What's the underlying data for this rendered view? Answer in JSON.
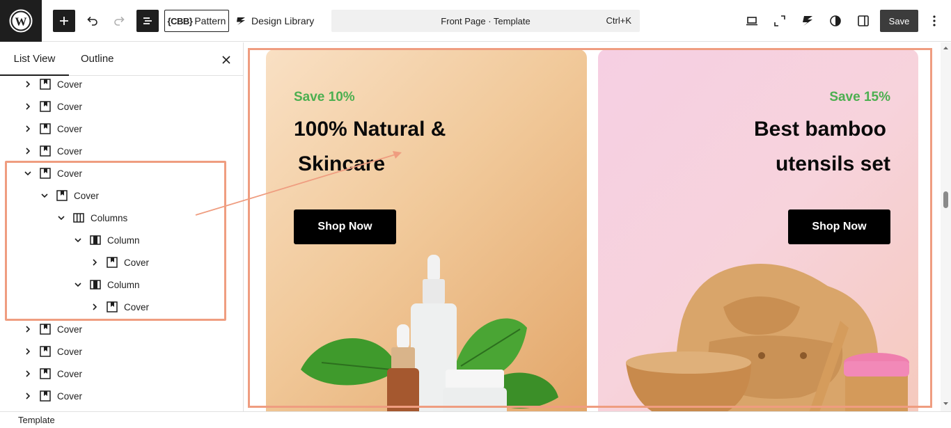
{
  "toolbar": {
    "pattern_mark": "{CBB}",
    "pattern_label": "Pattern",
    "design_library_label": "Design Library",
    "command_title": "Front Page · Template",
    "command_shortcut": "Ctrl+K",
    "save_label": "Save"
  },
  "sidebar": {
    "tabs": [
      "List View",
      "Outline"
    ],
    "tree": [
      {
        "label": "Cover",
        "level": 0,
        "expanded": false,
        "icon": "cover-icon"
      },
      {
        "label": "Cover",
        "level": 0,
        "expanded": false,
        "icon": "cover-icon"
      },
      {
        "label": "Cover",
        "level": 0,
        "expanded": false,
        "icon": "cover-icon"
      },
      {
        "label": "Cover",
        "level": 0,
        "expanded": false,
        "icon": "cover-icon"
      },
      {
        "label": "Cover",
        "level": 0,
        "expanded": true,
        "icon": "cover-icon"
      },
      {
        "label": "Cover",
        "level": 1,
        "expanded": true,
        "icon": "cover-icon"
      },
      {
        "label": "Columns",
        "level": 2,
        "expanded": true,
        "icon": "columns-icon"
      },
      {
        "label": "Column",
        "level": 3,
        "expanded": true,
        "icon": "column-icon"
      },
      {
        "label": "Cover",
        "level": 4,
        "expanded": false,
        "icon": "cover-icon"
      },
      {
        "label": "Column",
        "level": 3,
        "expanded": true,
        "icon": "column-icon"
      },
      {
        "label": "Cover",
        "level": 4,
        "expanded": false,
        "icon": "cover-icon"
      },
      {
        "label": "Cover",
        "level": 0,
        "expanded": false,
        "icon": "cover-icon"
      },
      {
        "label": "Cover",
        "level": 0,
        "expanded": false,
        "icon": "cover-icon"
      },
      {
        "label": "Cover",
        "level": 0,
        "expanded": false,
        "icon": "cover-icon"
      },
      {
        "label": "Cover",
        "level": 0,
        "expanded": false,
        "icon": "cover-icon"
      }
    ]
  },
  "status": {
    "label": "Template"
  },
  "canvas": {
    "left_card": {
      "save_text": "Save 10%",
      "headline_line1": "100% Natural &",
      "headline_line2": "Skincare",
      "button": "Shop Now"
    },
    "right_card": {
      "save_text": "Save 15%",
      "headline_line1": "Best bamboo",
      "headline_line2": "utensils set",
      "button": "Shop Now"
    }
  },
  "colors": {
    "accent_highlight": "#ef9d80",
    "save_green": "#4caf50",
    "dark": "#1e1e1e"
  }
}
